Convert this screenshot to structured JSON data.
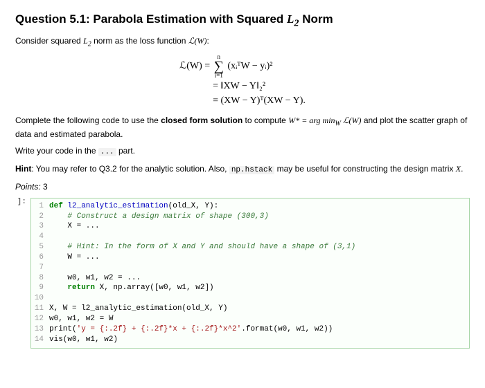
{
  "heading": {
    "prefix": "Question 5.1: Parabola Estimation with Squared ",
    "L": "L",
    "sub": "2",
    "suffix": " Norm"
  },
  "intro": {
    "a": "Consider squared ",
    "L": "L",
    "sub": "2",
    "b": " norm as the loss function ",
    "lw": "ℒ(W)",
    "c": ":"
  },
  "eq": {
    "lhs": "ℒ(W) = ",
    "sum_top": "n",
    "sum_bot": "i=1",
    "term1": "(xᵢᵀW − yᵢ)²",
    "line2": "= ‖XW − Y‖₂²",
    "line3": "= (XW − Y)ᵀ(XW − Y)."
  },
  "p1": {
    "a": "Complete the following code to use the ",
    "b": "closed form solution",
    "c": " to compute ",
    "w": "W* = arg min",
    "wsub": "W",
    "lw": " ℒ(W)",
    "d": " and plot the scatter graph of data and estimated parabola."
  },
  "p2": {
    "a": "Write your code in the ",
    "dots": "...",
    "b": " part."
  },
  "p3": {
    "a": "Hint",
    "b": ": You may refer to Q3.2 for the analytic solution. Also, ",
    "code": "np.hstack",
    "c": " may be useful for constructing the design matrix ",
    "x": "X",
    "d": "."
  },
  "points": {
    "label": "Points:",
    "val": " 3"
  },
  "prompt": "]:",
  "code": {
    "l1_def": "def ",
    "l1_name": "l2_analytic_estimation",
    "l1_rest": "(old_X, Y):",
    "l2": "    # Construct a design matrix of shape (300,3)",
    "l3": "    X = ...",
    "l4": "",
    "l5": "    # Hint: In the form of X and Y and should have a shape of (3,1)",
    "l6": "    W = ...",
    "l7": "",
    "l8": "    w0, w1, w2 = ...",
    "l9a": "    ",
    "l9_ret": "return",
    "l9b": " X, np.array([w0, w1, w2])",
    "l10": "",
    "l11": "X, W = l2_analytic_estimation(old_X, Y)",
    "l12": "w0, w1, w2 = W",
    "l13a": "print(",
    "l13s": "'y = {:.2f} + {:.2f}*x + {:.2f}*x^2'",
    "l13b": ".format(w0, w1, w2))",
    "l14": "vis(w0, w1, w2)"
  },
  "nums": [
    "1",
    "2",
    "3",
    "4",
    "5",
    "6",
    "7",
    "8",
    "9",
    "10",
    "11",
    "12",
    "13",
    "14"
  ]
}
